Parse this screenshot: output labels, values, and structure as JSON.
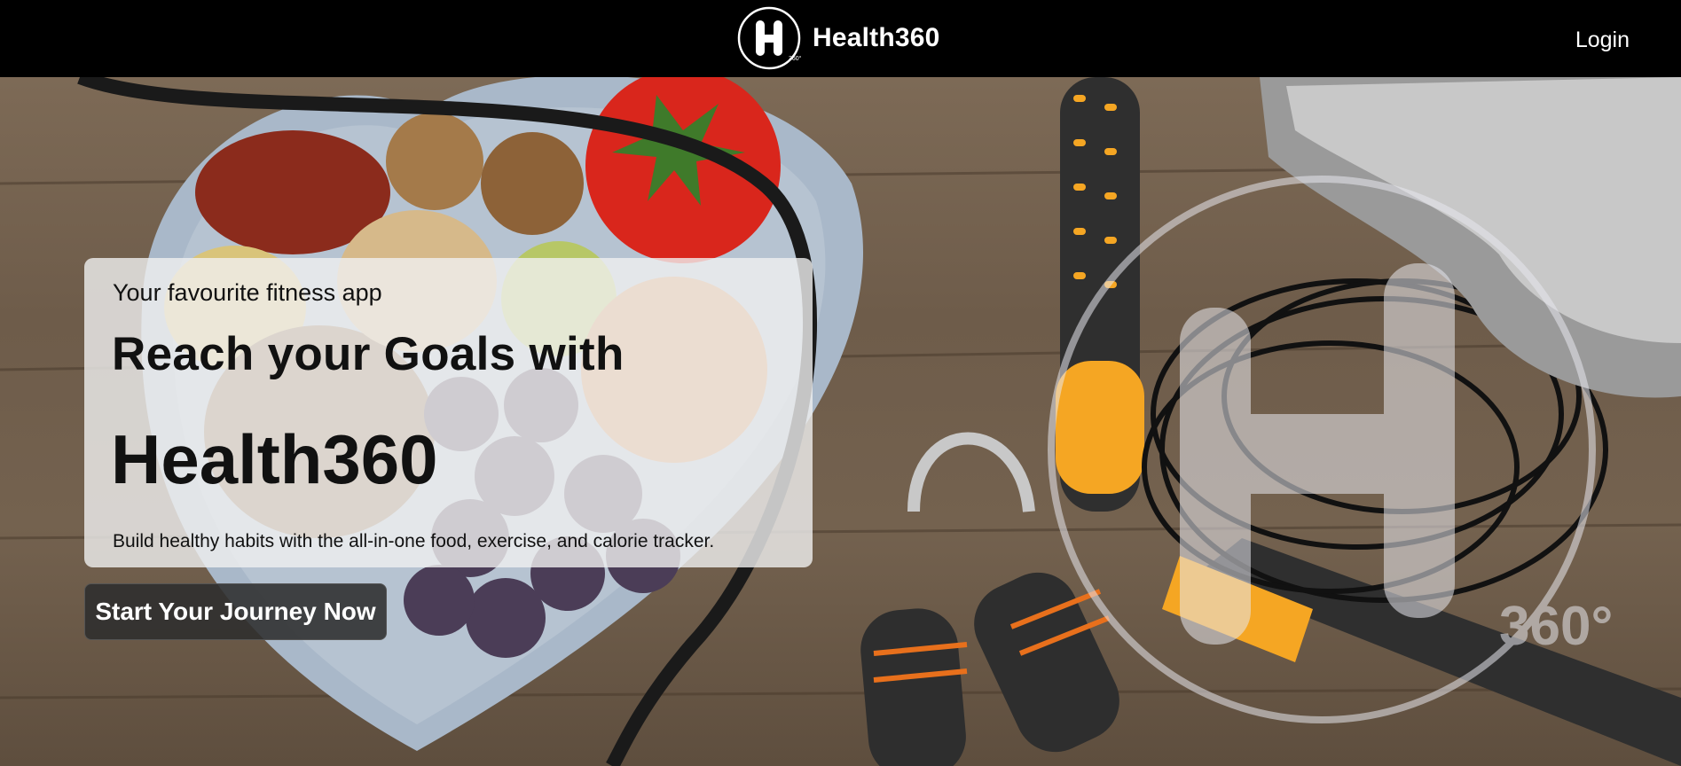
{
  "navbar": {
    "brand_name": "Health360",
    "logo_letter": "H",
    "logo_suffix": "360°",
    "login_label": "Login"
  },
  "hero": {
    "tagline": "Your favourite fitness app",
    "headline": "Reach your Goals with",
    "brand": "Health360",
    "description": "Build healthy habits with the all-in-one food, exercise, and calorie tracker.",
    "cta_label": "Start Your Journey Now",
    "watermark_text": "360°"
  },
  "colors": {
    "navbar_bg": "#000000",
    "card_bg": "rgba(240,240,240,0.80)",
    "cta_bg": "#2d2d2d",
    "jump_rope_accent": "#f5a623",
    "tomato": "#d9261c"
  }
}
